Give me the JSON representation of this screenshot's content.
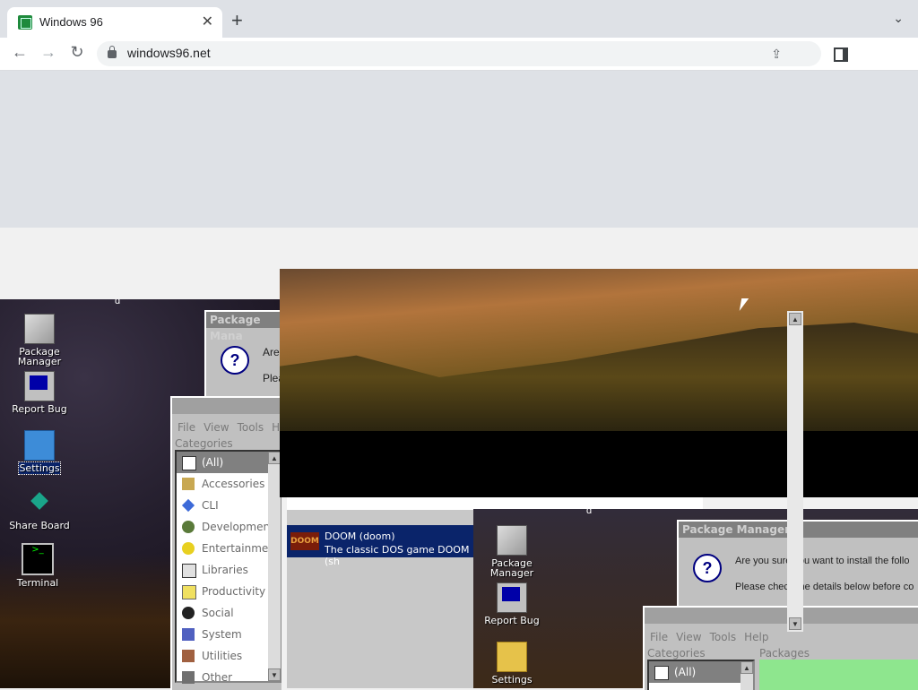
{
  "browser": {
    "tab_title": "Windows 96",
    "new_tab": "+",
    "url": "windows96.net"
  },
  "desktop": {
    "marker": "d",
    "icons": [
      {
        "label": "Package Manager",
        "icon": "package-icon"
      },
      {
        "label": "Report Bug",
        "icon": "monitor-icon"
      },
      {
        "label": "Settings",
        "icon": "folder-icon"
      },
      {
        "label": "Share Board",
        "icon": "share-icon"
      },
      {
        "label": "Terminal",
        "icon": "terminal-icon"
      }
    ]
  },
  "package_dialog_back": {
    "title": "Package Mana",
    "line1": "Are",
    "line2": "Plea"
  },
  "pm_window_back": {
    "menu": [
      "File",
      "View",
      "Tools",
      "He"
    ],
    "categories_label": "Categories",
    "categories": [
      "(All)",
      "Accessories",
      "CLI",
      "Development",
      "Entertainment",
      "Libraries",
      "Productivity",
      "Social",
      "System",
      "Utilities",
      "Other"
    ]
  },
  "package_row": {
    "logo": "DOOM",
    "name": "DOOM (doom)",
    "description": "The classic DOS game DOOM (sh"
  },
  "desktop2": {
    "marker": "d",
    "icons": [
      {
        "label": "Package Manager"
      },
      {
        "label": "Report Bug"
      },
      {
        "label": "Settings"
      }
    ]
  },
  "package_dialog_front": {
    "title": "Package Manager",
    "line1": "Are you sure you want to install the follo",
    "line2": "Please check the details below before co"
  },
  "pm_window_front": {
    "menu": [
      "File",
      "View",
      "Tools",
      "Help"
    ],
    "categories_label": "Categories",
    "packages_label": "Packages",
    "first_category": "(All)"
  },
  "scrollbar": {
    "up": "▲",
    "down": "▼"
  }
}
